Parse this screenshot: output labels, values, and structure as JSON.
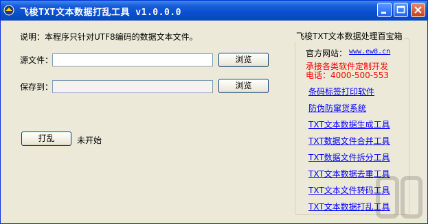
{
  "window": {
    "title": "飞梭TXT文本数据打乱工具 v1.0.0.0"
  },
  "main": {
    "description": "说明：本程序只针对UTF8编码的数据文本文件。",
    "source_label": "源文件：",
    "source_value": "",
    "save_label": "保存到：",
    "save_value": "",
    "browse_label": "浏览",
    "shuffle_label": "打乱",
    "status": "未开始"
  },
  "sidebar": {
    "title": "飞梭TXT文本数据处理百宝箱",
    "website_label": "官方网站：",
    "website": "www.ew8.cn",
    "custom_dev": "承接各类软件定制开发",
    "phone": "电话：4000-500-553",
    "links": [
      "条码标签打印软件",
      "防伪防窜货系统",
      "TXT文本数据生成工具",
      "TXT数据文件合并工具",
      "TXT数据文件拆分工具",
      "TXT文本数据去重工具",
      "TXT文本文件转码工具",
      "TXT文本数据打乱工具"
    ]
  },
  "colors": {
    "title_bar": "#0a46c0",
    "link": "#0000ff",
    "accent_red": "#ff0000",
    "background": "#ece9d8"
  }
}
